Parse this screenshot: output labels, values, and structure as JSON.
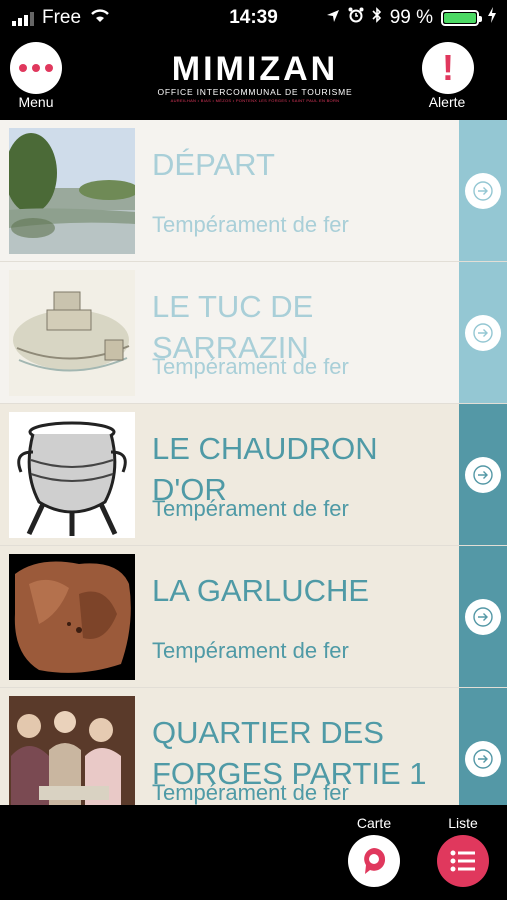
{
  "status_bar": {
    "carrier": "Free",
    "time": "14:39",
    "battery_text": "99 %",
    "battery_level": 0.99
  },
  "header": {
    "menu_label": "Menu",
    "alert_label": "Alerte",
    "logo_title": "MIMIZAN",
    "logo_subtitle": "OFFICE INTERCOMMUNAL DE TOURISME",
    "logo_towns": "AUREILHAN • BIAS • MÉZOS • PONTENX LES FORGES • SAINT PAUL EN BORN"
  },
  "items": [
    {
      "title": "DÉPART",
      "subtitle": "Tempérament de fer",
      "style": "light",
      "image": "river-landscape"
    },
    {
      "title": "LE TUC DE SARRAZIN",
      "subtitle": "Tempérament de fer",
      "style": "light",
      "image": "castle-drawing"
    },
    {
      "title": "LE CHAUDRON D'OR",
      "subtitle": "Tempérament de fer",
      "style": "dark",
      "image": "cauldron-engraving"
    },
    {
      "title": "LA GARLUCHE",
      "subtitle": "Tempérament de fer",
      "style": "dark",
      "image": "rock-stone"
    },
    {
      "title": "QUARTIER DES FORGES PARTIE 1",
      "subtitle": "Tempérament de fer",
      "style": "dark",
      "image": "painting-group"
    }
  ],
  "footer": {
    "map_label": "Carte",
    "list_label": "Liste"
  },
  "colors": {
    "accent": "#e0385d",
    "teal_light": "#94c7d3",
    "teal_dark": "#5498a6"
  }
}
